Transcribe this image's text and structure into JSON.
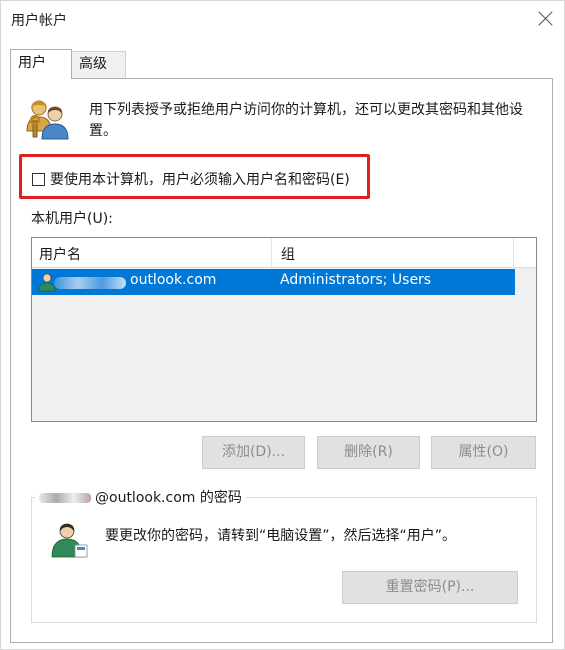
{
  "window": {
    "title": "用户帐户"
  },
  "tabs": [
    {
      "label": "用户"
    },
    {
      "label": "高级"
    }
  ],
  "description": "用下列表授予或拒绝用户访问你的计算机，还可以更改其密码和其他设置。",
  "require_password": {
    "label": "要使用本计算机，用户必须输入用户名和密码(E)",
    "checked": false,
    "highlight_color": "#e02020"
  },
  "local_users": {
    "label": "本机用户(U):",
    "columns": [
      "用户名",
      "组"
    ],
    "rows": [
      {
        "username": "outlook.com",
        "group": "Administrators; Users",
        "selected": true
      }
    ],
    "selection_color": "#0078d7"
  },
  "buttons": {
    "add": "添加(D)...",
    "remove": "删除(R)",
    "properties": "属性(O)"
  },
  "password_section": {
    "title": "@outlook.com 的密码",
    "description": "要更改你的密码，请转到“电脑设置”，然后选择“用户”。",
    "reset_button": "重置密码(P)..."
  },
  "icons": [
    "users-icon",
    "user-avatar-icon",
    "close-icon"
  ]
}
